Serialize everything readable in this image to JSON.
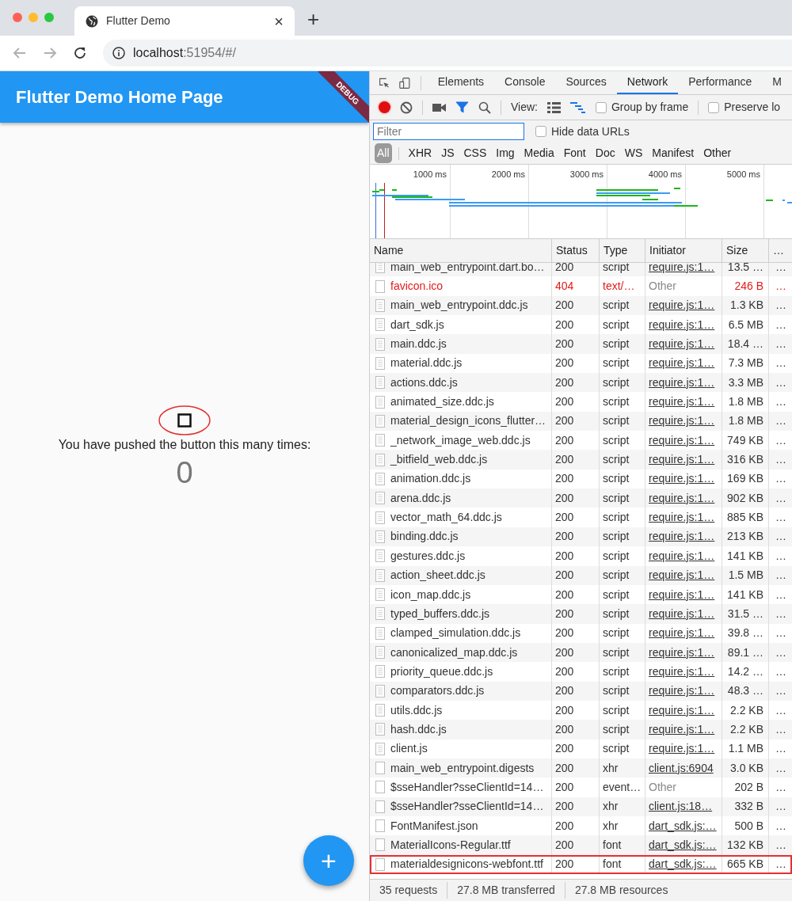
{
  "browser": {
    "tab": {
      "title": "Flutter Demo",
      "close": "×"
    },
    "new_tab": "+",
    "nav": {
      "back_disabled": true,
      "forward_disabled": true
    },
    "url": {
      "host": "localhost",
      "rest": ":51954/#/"
    }
  },
  "app": {
    "title": "Flutter Demo Home Page",
    "banner": "DEBUG",
    "message": "You have pushed the button this many times:",
    "counter": "0",
    "fab": "+"
  },
  "devtools": {
    "tabs": [
      {
        "label": "Elements",
        "selected": false
      },
      {
        "label": "Console",
        "selected": false
      },
      {
        "label": "Sources",
        "selected": false
      },
      {
        "label": "Network",
        "selected": true
      },
      {
        "label": "Performance",
        "selected": false
      },
      {
        "label": "M",
        "selected": false
      }
    ],
    "toolbar": {
      "recording": true,
      "filter_active": true,
      "view_label": "View:",
      "large_rows": false,
      "waterfall": true,
      "options": [
        {
          "label": "Group by frame",
          "checked": false
        },
        {
          "label": "Preserve lo",
          "checked": false
        }
      ]
    },
    "filter": {
      "placeholder": "Filter",
      "hide_data_urls": {
        "label": "Hide data URLs",
        "checked": false
      }
    },
    "types": [
      {
        "label": "All",
        "selected": true
      },
      {
        "label": "XHR",
        "selected": false
      },
      {
        "label": "JS",
        "selected": false
      },
      {
        "label": "CSS",
        "selected": false
      },
      {
        "label": "Img",
        "selected": false
      },
      {
        "label": "Media",
        "selected": false
      },
      {
        "label": "Font",
        "selected": false
      },
      {
        "label": "Doc",
        "selected": false
      },
      {
        "label": "WS",
        "selected": false
      },
      {
        "label": "Manifest",
        "selected": false
      },
      {
        "label": "Other",
        "selected": false
      }
    ],
    "overview_ticks": [
      "1000 ms",
      "2000 ms",
      "3000 ms",
      "4000 ms",
      "5000 ms"
    ],
    "table": {
      "columns": [
        "Name",
        "Status",
        "Type",
        "Initiator",
        "Size",
        "…"
      ],
      "rows": [
        {
          "kind": "script",
          "name": "main_web_entrypoint.dart.bo…",
          "status": "200",
          "type": "script",
          "initiator": "require.js:1…",
          "initiator_link": true,
          "size": "13.5 …",
          "more": "…",
          "error": false,
          "highlighted": false
        },
        {
          "kind": "plain",
          "name": "favicon.ico",
          "status": "404",
          "type": "text/…",
          "initiator": "Other",
          "initiator_link": false,
          "size": "246 B",
          "more": "…",
          "error": true,
          "highlighted": false
        },
        {
          "kind": "script",
          "name": "main_web_entrypoint.ddc.js",
          "status": "200",
          "type": "script",
          "initiator": "require.js:1…",
          "initiator_link": true,
          "size": "1.3 KB",
          "more": "…",
          "error": false,
          "highlighted": false
        },
        {
          "kind": "script",
          "name": "dart_sdk.js",
          "status": "200",
          "type": "script",
          "initiator": "require.js:1…",
          "initiator_link": true,
          "size": "6.5 MB",
          "more": "…",
          "error": false,
          "highlighted": false
        },
        {
          "kind": "script",
          "name": "main.ddc.js",
          "status": "200",
          "type": "script",
          "initiator": "require.js:1…",
          "initiator_link": true,
          "size": "18.4 …",
          "more": "…",
          "error": false,
          "highlighted": false
        },
        {
          "kind": "script",
          "name": "material.ddc.js",
          "status": "200",
          "type": "script",
          "initiator": "require.js:1…",
          "initiator_link": true,
          "size": "7.3 MB",
          "more": "…",
          "error": false,
          "highlighted": false
        },
        {
          "kind": "script",
          "name": "actions.ddc.js",
          "status": "200",
          "type": "script",
          "initiator": "require.js:1…",
          "initiator_link": true,
          "size": "3.3 MB",
          "more": "…",
          "error": false,
          "highlighted": false
        },
        {
          "kind": "script",
          "name": "animated_size.ddc.js",
          "status": "200",
          "type": "script",
          "initiator": "require.js:1…",
          "initiator_link": true,
          "size": "1.8 MB",
          "more": "…",
          "error": false,
          "highlighted": false
        },
        {
          "kind": "script",
          "name": "material_design_icons_flutter…",
          "status": "200",
          "type": "script",
          "initiator": "require.js:1…",
          "initiator_link": true,
          "size": "1.8 MB",
          "more": "…",
          "error": false,
          "highlighted": false
        },
        {
          "kind": "script",
          "name": "_network_image_web.ddc.js",
          "status": "200",
          "type": "script",
          "initiator": "require.js:1…",
          "initiator_link": true,
          "size": "749 KB",
          "more": "…",
          "error": false,
          "highlighted": false
        },
        {
          "kind": "script",
          "name": "_bitfield_web.ddc.js",
          "status": "200",
          "type": "script",
          "initiator": "require.js:1…",
          "initiator_link": true,
          "size": "316 KB",
          "more": "…",
          "error": false,
          "highlighted": false
        },
        {
          "kind": "script",
          "name": "animation.ddc.js",
          "status": "200",
          "type": "script",
          "initiator": "require.js:1…",
          "initiator_link": true,
          "size": "169 KB",
          "more": "…",
          "error": false,
          "highlighted": false
        },
        {
          "kind": "script",
          "name": "arena.ddc.js",
          "status": "200",
          "type": "script",
          "initiator": "require.js:1…",
          "initiator_link": true,
          "size": "902 KB",
          "more": "…",
          "error": false,
          "highlighted": false
        },
        {
          "kind": "script",
          "name": "vector_math_64.ddc.js",
          "status": "200",
          "type": "script",
          "initiator": "require.js:1…",
          "initiator_link": true,
          "size": "885 KB",
          "more": "…",
          "error": false,
          "highlighted": false
        },
        {
          "kind": "script",
          "name": "binding.ddc.js",
          "status": "200",
          "type": "script",
          "initiator": "require.js:1…",
          "initiator_link": true,
          "size": "213 KB",
          "more": "…",
          "error": false,
          "highlighted": false
        },
        {
          "kind": "script",
          "name": "gestures.ddc.js",
          "status": "200",
          "type": "script",
          "initiator": "require.js:1…",
          "initiator_link": true,
          "size": "141 KB",
          "more": "…",
          "error": false,
          "highlighted": false
        },
        {
          "kind": "script",
          "name": "action_sheet.ddc.js",
          "status": "200",
          "type": "script",
          "initiator": "require.js:1…",
          "initiator_link": true,
          "size": "1.5 MB",
          "more": "…",
          "error": false,
          "highlighted": false
        },
        {
          "kind": "script",
          "name": "icon_map.ddc.js",
          "status": "200",
          "type": "script",
          "initiator": "require.js:1…",
          "initiator_link": true,
          "size": "141 KB",
          "more": "…",
          "error": false,
          "highlighted": false
        },
        {
          "kind": "script",
          "name": "typed_buffers.ddc.js",
          "status": "200",
          "type": "script",
          "initiator": "require.js:1…",
          "initiator_link": true,
          "size": "31.5 …",
          "more": "…",
          "error": false,
          "highlighted": false
        },
        {
          "kind": "script",
          "name": "clamped_simulation.ddc.js",
          "status": "200",
          "type": "script",
          "initiator": "require.js:1…",
          "initiator_link": true,
          "size": "39.8 …",
          "more": "…",
          "error": false,
          "highlighted": false
        },
        {
          "kind": "script",
          "name": "canonicalized_map.ddc.js",
          "status": "200",
          "type": "script",
          "initiator": "require.js:1…",
          "initiator_link": true,
          "size": "89.1 …",
          "more": "…",
          "error": false,
          "highlighted": false
        },
        {
          "kind": "script",
          "name": "priority_queue.ddc.js",
          "status": "200",
          "type": "script",
          "initiator": "require.js:1…",
          "initiator_link": true,
          "size": "14.2 …",
          "more": "…",
          "error": false,
          "highlighted": false
        },
        {
          "kind": "script",
          "name": "comparators.ddc.js",
          "status": "200",
          "type": "script",
          "initiator": "require.js:1…",
          "initiator_link": true,
          "size": "48.3 …",
          "more": "…",
          "error": false,
          "highlighted": false
        },
        {
          "kind": "script",
          "name": "utils.ddc.js",
          "status": "200",
          "type": "script",
          "initiator": "require.js:1…",
          "initiator_link": true,
          "size": "2.2 KB",
          "more": "…",
          "error": false,
          "highlighted": false
        },
        {
          "kind": "script",
          "name": "hash.ddc.js",
          "status": "200",
          "type": "script",
          "initiator": "require.js:1…",
          "initiator_link": true,
          "size": "2.2 KB",
          "more": "…",
          "error": false,
          "highlighted": false
        },
        {
          "kind": "script",
          "name": "client.js",
          "status": "200",
          "type": "script",
          "initiator": "require.js:1…",
          "initiator_link": true,
          "size": "1.1 MB",
          "more": "…",
          "error": false,
          "highlighted": false
        },
        {
          "kind": "plain",
          "name": "main_web_entrypoint.digests",
          "status": "200",
          "type": "xhr",
          "initiator": "client.js:6904",
          "initiator_link": true,
          "size": "3.0 KB",
          "more": "…",
          "error": false,
          "highlighted": false
        },
        {
          "kind": "plain",
          "name": "$sseHandler?sseClientId=14…",
          "status": "200",
          "type": "event…",
          "initiator": "Other",
          "initiator_link": false,
          "size": "202 B",
          "more": "…",
          "error": false,
          "highlighted": false
        },
        {
          "kind": "plain",
          "name": "$sseHandler?sseClientId=14…",
          "status": "200",
          "type": "xhr",
          "initiator": "client.js:18…",
          "initiator_link": true,
          "size": "332 B",
          "more": "…",
          "error": false,
          "highlighted": false
        },
        {
          "kind": "plain",
          "name": "FontManifest.json",
          "status": "200",
          "type": "xhr",
          "initiator": "dart_sdk.js:…",
          "initiator_link": true,
          "size": "500 B",
          "more": "…",
          "error": false,
          "highlighted": false
        },
        {
          "kind": "plain",
          "name": "MaterialIcons-Regular.ttf",
          "status": "200",
          "type": "font",
          "initiator": "dart_sdk.js:…",
          "initiator_link": true,
          "size": "132 KB",
          "more": "…",
          "error": false,
          "highlighted": false
        },
        {
          "kind": "plain",
          "name": "materialdesignicons-webfont.ttf",
          "status": "200",
          "type": "font",
          "initiator": "dart_sdk.js:…",
          "initiator_link": true,
          "size": "665 KB",
          "more": "…",
          "error": false,
          "highlighted": true
        }
      ]
    },
    "summary": [
      "35 requests",
      "27.8 MB transferred",
      "27.8 MB resources"
    ]
  }
}
